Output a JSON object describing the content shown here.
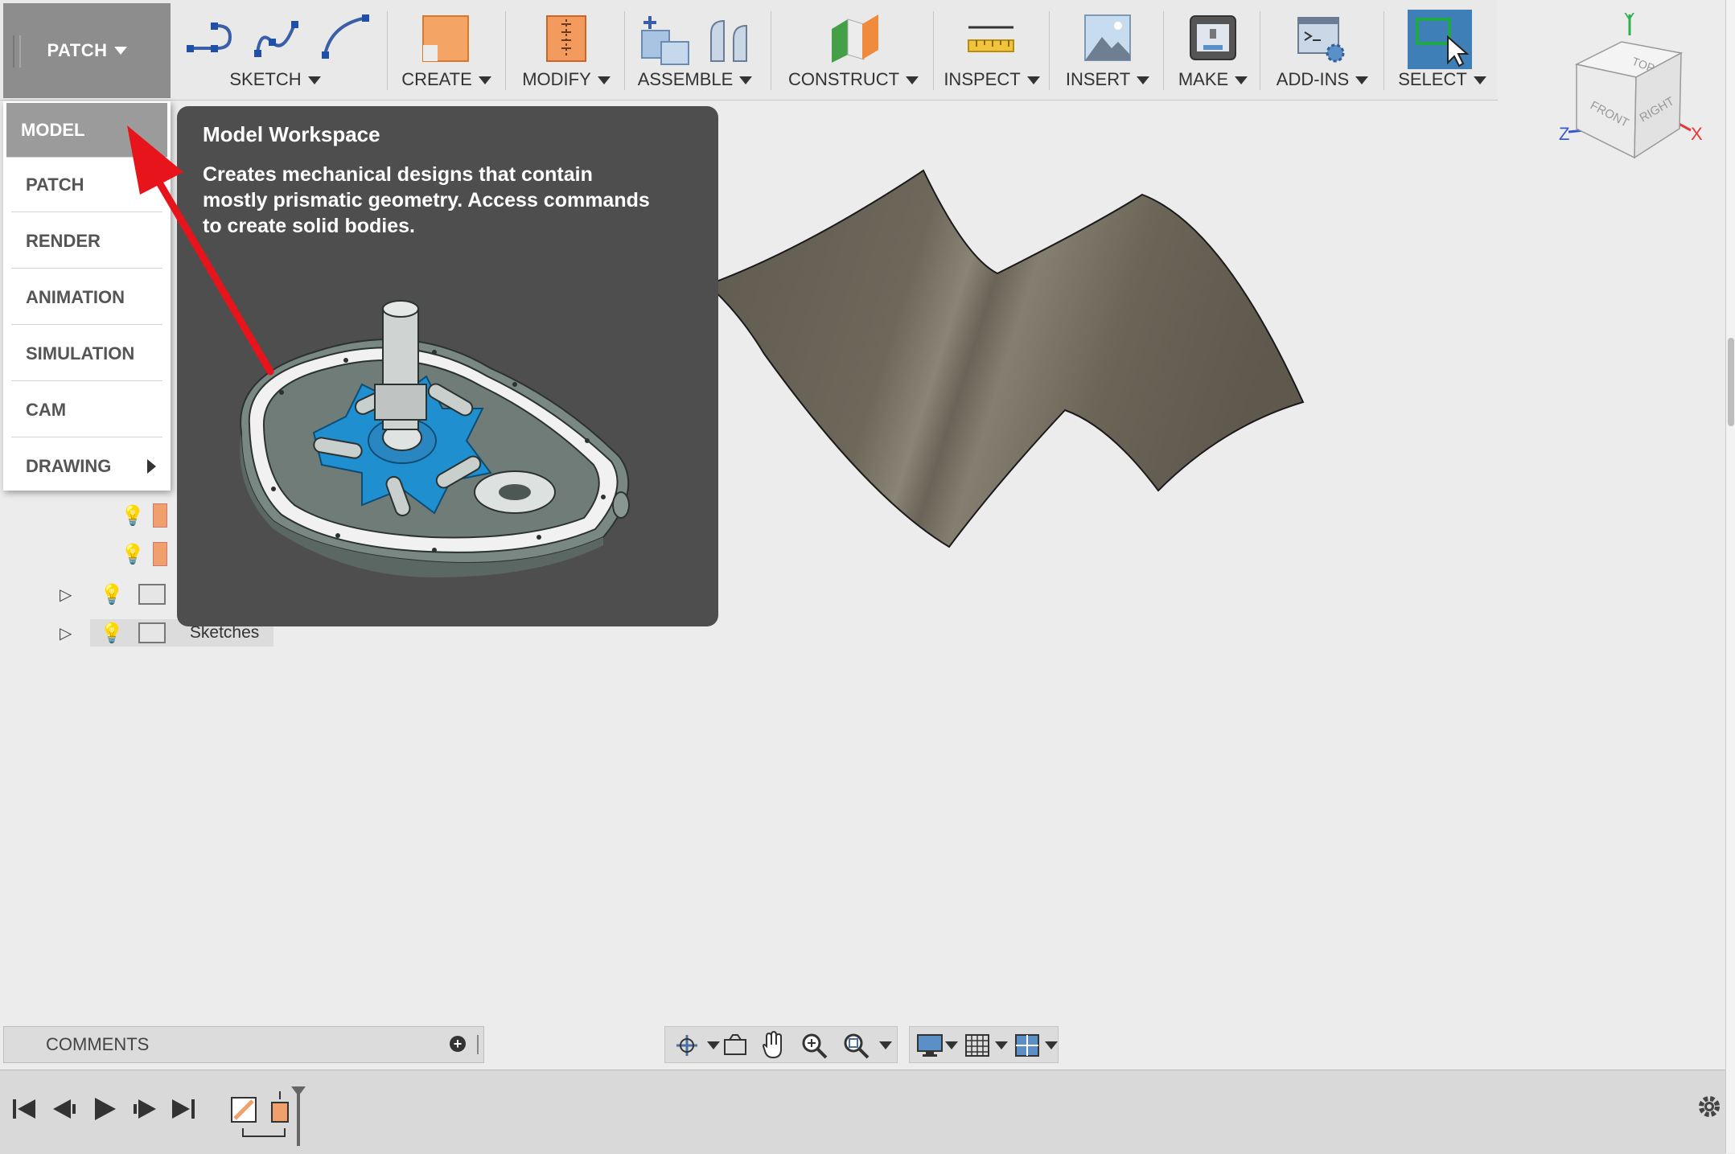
{
  "toolbar": {
    "workspace_label": "PATCH",
    "groups": [
      {
        "label": "SKETCH"
      },
      {
        "label": "CREATE"
      },
      {
        "label": "MODIFY"
      },
      {
        "label": "ASSEMBLE"
      },
      {
        "label": "CONSTRUCT"
      },
      {
        "label": "INSPECT"
      },
      {
        "label": "INSERT"
      },
      {
        "label": "MAKE"
      },
      {
        "label": "ADD-INS"
      },
      {
        "label": "SELECT"
      }
    ]
  },
  "workspace_menu": {
    "items": [
      {
        "label": "MODEL",
        "active": true
      },
      {
        "label": "PATCH"
      },
      {
        "label": "RENDER"
      },
      {
        "label": "ANIMATION"
      },
      {
        "label": "SIMULATION"
      },
      {
        "label": "CAM"
      },
      {
        "label": "DRAWING",
        "has_submenu": true
      }
    ]
  },
  "tooltip": {
    "title": "Model Workspace",
    "description": "Creates mechanical designs that contain mostly prismatic geometry. Access commands to create solid bodies."
  },
  "browser": {
    "sketches_label": "Sketches"
  },
  "viewcube": {
    "top": "TOP",
    "front": "FRONT",
    "right": "RIGHT",
    "axis_x": "X",
    "axis_y": "Y",
    "axis_z": "Z"
  },
  "comments": {
    "label": "COMMENTS"
  },
  "colors": {
    "toolbar_bg": "#e9e9e9",
    "workspace_button": "#8d8d8d",
    "tooltip_bg": "#4e4e4e",
    "select_active": "#3d7fb6",
    "arrow": "#e8141b",
    "surface": "#6b6558"
  },
  "icons": [
    "line-icon",
    "spline-icon",
    "arc-icon",
    "create-box-icon",
    "modify-icon",
    "new-component-icon",
    "joint-icon",
    "construct-plane-icon",
    "measure-icon",
    "insert-image-icon",
    "3d-print-icon",
    "scripts-icon",
    "select-window-icon"
  ]
}
